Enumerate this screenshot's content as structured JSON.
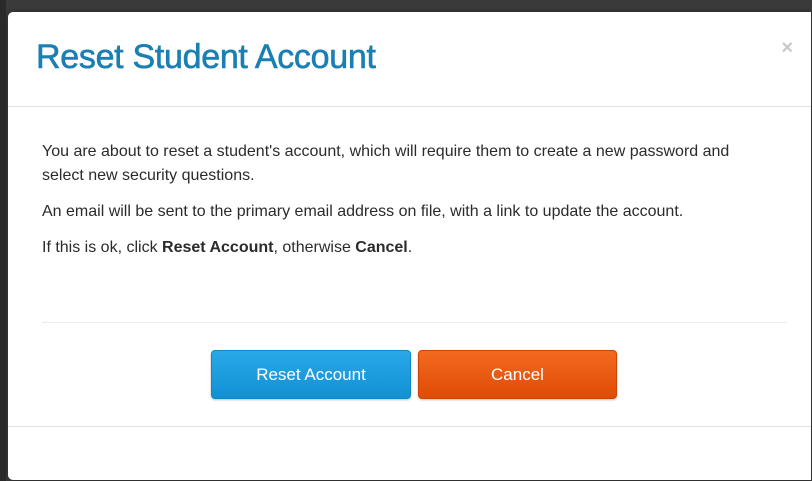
{
  "dialog": {
    "title": "Reset Student Account",
    "close_label": "×",
    "paragraph1": "You are about to reset a student's account, which will require them to create a new password and select new security questions.",
    "paragraph2": "An email will be sent to the primary email address on file, with a link to update the account.",
    "paragraph3_prefix": "If this is ok, click ",
    "paragraph3_reset": "Reset Account",
    "paragraph3_middle": ", otherwise ",
    "paragraph3_cancel": "Cancel",
    "paragraph3_suffix": ".",
    "reset_button_label": "Reset Account",
    "cancel_button_label": "Cancel"
  },
  "colors": {
    "title": "#1a7fb3",
    "reset_button": "#1a9ee0",
    "cancel_button": "#e85a10"
  }
}
